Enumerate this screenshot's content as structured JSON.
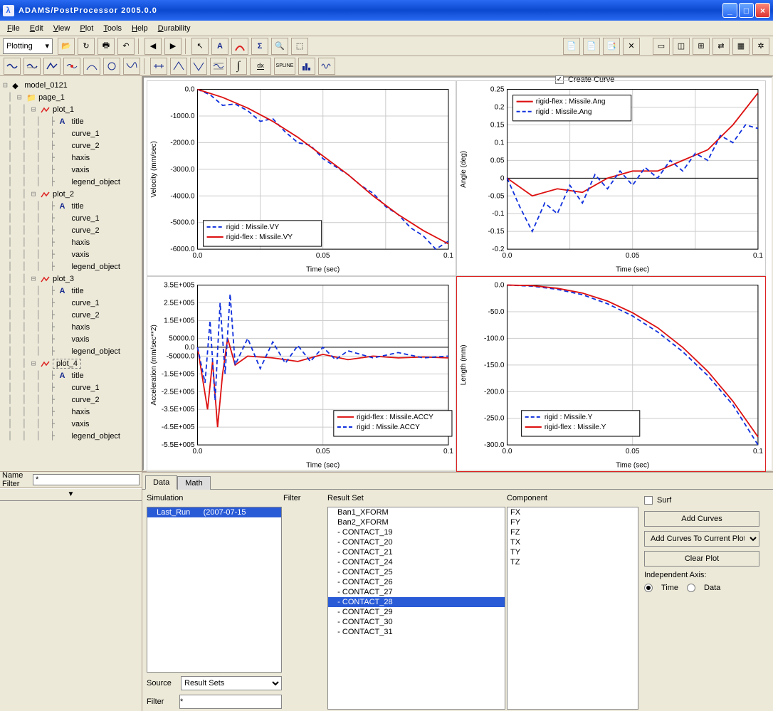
{
  "window": {
    "title": "ADAMS/PostProcessor 2005.0.0"
  },
  "menu": [
    "File",
    "Edit",
    "View",
    "Plot",
    "Tools",
    "Help",
    "Durability"
  ],
  "mode_select": "Plotting",
  "create_curve_label": "Create Curve",
  "create_curve_checked": true,
  "name_filter_label": "Name Filter",
  "name_filter_value": "*",
  "tree": [
    {
      "d": 0,
      "exp": "-",
      "icon": "model",
      "label": "model_0121"
    },
    {
      "d": 1,
      "exp": "-",
      "icon": "folder",
      "label": "page_1"
    },
    {
      "d": 2,
      "exp": "-",
      "icon": "plot",
      "label": "plot_1"
    },
    {
      "d": 3,
      "exp": "",
      "icon": "A",
      "label": "title"
    },
    {
      "d": 3,
      "exp": "",
      "icon": "blank",
      "label": "curve_1"
    },
    {
      "d": 3,
      "exp": "",
      "icon": "blank",
      "label": "curve_2"
    },
    {
      "d": 3,
      "exp": "",
      "icon": "blank",
      "label": "haxis"
    },
    {
      "d": 3,
      "exp": "",
      "icon": "blank",
      "label": "vaxis"
    },
    {
      "d": 3,
      "exp": "",
      "icon": "blank",
      "label": "legend_object"
    },
    {
      "d": 2,
      "exp": "-",
      "icon": "plot",
      "label": "plot_2"
    },
    {
      "d": 3,
      "exp": "",
      "icon": "A",
      "label": "title"
    },
    {
      "d": 3,
      "exp": "",
      "icon": "blank",
      "label": "curve_1"
    },
    {
      "d": 3,
      "exp": "",
      "icon": "blank",
      "label": "curve_2"
    },
    {
      "d": 3,
      "exp": "",
      "icon": "blank",
      "label": "haxis"
    },
    {
      "d": 3,
      "exp": "",
      "icon": "blank",
      "label": "vaxis"
    },
    {
      "d": 3,
      "exp": "",
      "icon": "blank",
      "label": "legend_object"
    },
    {
      "d": 2,
      "exp": "-",
      "icon": "plot",
      "label": "plot_3"
    },
    {
      "d": 3,
      "exp": "",
      "icon": "A",
      "label": "title"
    },
    {
      "d": 3,
      "exp": "",
      "icon": "blank",
      "label": "curve_1"
    },
    {
      "d": 3,
      "exp": "",
      "icon": "blank",
      "label": "curve_2"
    },
    {
      "d": 3,
      "exp": "",
      "icon": "blank",
      "label": "haxis"
    },
    {
      "d": 3,
      "exp": "",
      "icon": "blank",
      "label": "vaxis"
    },
    {
      "d": 3,
      "exp": "",
      "icon": "blank",
      "label": "legend_object"
    },
    {
      "d": 2,
      "exp": "-",
      "icon": "plot",
      "label": "plot_4",
      "sel": true
    },
    {
      "d": 3,
      "exp": "",
      "icon": "A",
      "label": "title"
    },
    {
      "d": 3,
      "exp": "",
      "icon": "blank",
      "label": "curve_1"
    },
    {
      "d": 3,
      "exp": "",
      "icon": "blank",
      "label": "curve_2"
    },
    {
      "d": 3,
      "exp": "",
      "icon": "blank",
      "label": "haxis"
    },
    {
      "d": 3,
      "exp": "",
      "icon": "blank",
      "label": "vaxis"
    },
    {
      "d": 3,
      "exp": "",
      "icon": "blank",
      "label": "legend_object"
    }
  ],
  "tabs": [
    "Data",
    "Math"
  ],
  "active_tab": "Data",
  "panel": {
    "simulation_label": "Simulation",
    "filter_label": "Filter",
    "resultset_label": "Result Set",
    "component_label": "Component",
    "surf_label": "Surf",
    "surf_checked": false,
    "add_curves": "Add Curves",
    "plot_target": "Add Curves To Current Plot",
    "clear_plot": "Clear Plot",
    "independent_axis": "Independent Axis:",
    "axis_time": "Time",
    "axis_data": "Data",
    "axis_selected": "Time",
    "source_label": "Source",
    "source_value": "Result Sets",
    "filter2_label": "Filter",
    "filter2_value": "*",
    "simulations": [
      {
        "name": "Last_Run",
        "date": "(2007-07-15",
        "sel": true
      }
    ],
    "result_sets": [
      "Ban1_XFORM",
      "Ban2_XFORM",
      "- CONTACT_19",
      "- CONTACT_20",
      "- CONTACT_21",
      "- CONTACT_24",
      "- CONTACT_25",
      "- CONTACT_26",
      "- CONTACT_27",
      "- CONTACT_28",
      "- CONTACT_29",
      "- CONTACT_30",
      "- CONTACT_31"
    ],
    "result_sel": "- CONTACT_28",
    "components": [
      "FX",
      "FY",
      "FZ",
      "TX",
      "TY",
      "TZ"
    ]
  },
  "chart_data": [
    {
      "type": "line",
      "title": "",
      "xlabel": "Time (sec)",
      "ylabel": "Velocity (mm/sec)",
      "xlim": [
        0.0,
        0.1
      ],
      "ylim": [
        -6000,
        0
      ],
      "xticks": [
        0.0,
        0.025,
        0.05,
        0.075,
        0.1
      ],
      "xtick_labels": [
        "0.0",
        "",
        "0.05",
        "",
        "0.1"
      ],
      "yticks": [
        0,
        -1000,
        -2000,
        -3000,
        -4000,
        -5000,
        -6000
      ],
      "ytick_labels": [
        "0.0",
        "-1000.0",
        "-2000.0",
        "-3000.0",
        "-4000.0",
        "-5000.0",
        "-6000.0"
      ],
      "series": [
        {
          "name": "rigid : Missile.VY",
          "color": "#1030dd",
          "dash": true,
          "x": [
            0.0,
            0.005,
            0.01,
            0.015,
            0.02,
            0.025,
            0.03,
            0.035,
            0.04,
            0.045,
            0.05,
            0.055,
            0.06,
            0.065,
            0.07,
            0.075,
            0.08,
            0.085,
            0.09,
            0.095,
            0.1
          ],
          "y": [
            0,
            -200,
            -600,
            -550,
            -800,
            -1200,
            -1100,
            -1600,
            -2000,
            -2100,
            -2600,
            -2900,
            -3200,
            -3600,
            -3900,
            -4400,
            -4700,
            -5200,
            -5500,
            -6000,
            -5700
          ]
        },
        {
          "name": "rigid-flex : Missile.VY",
          "color": "#dd1010",
          "dash": false,
          "x": [
            0.0,
            0.01,
            0.02,
            0.03,
            0.04,
            0.05,
            0.06,
            0.07,
            0.08,
            0.09,
            0.1
          ],
          "y": [
            0,
            -300,
            -700,
            -1200,
            -1800,
            -2500,
            -3200,
            -4000,
            -4700,
            -5300,
            -5800
          ]
        }
      ],
      "legend_pos": "bottom-left"
    },
    {
      "type": "line",
      "xlabel": "Time (sec)",
      "ylabel": "Angle (deg)",
      "xlim": [
        0.0,
        0.1
      ],
      "ylim": [
        -0.2,
        0.25
      ],
      "xticks": [
        0.0,
        0.025,
        0.05,
        0.075,
        0.1
      ],
      "xtick_labels": [
        "0.0",
        "",
        "0.05",
        "",
        "0.1"
      ],
      "yticks": [
        -0.2,
        -0.15,
        -0.1,
        -0.05,
        0.0,
        0.05,
        0.1,
        0.15,
        0.2,
        0.25
      ],
      "series": [
        {
          "name": "rigid-flex : Missile.Ang",
          "color": "#dd1010",
          "dash": false,
          "x": [
            0.0,
            0.01,
            0.02,
            0.03,
            0.04,
            0.05,
            0.06,
            0.07,
            0.08,
            0.09,
            0.1
          ],
          "y": [
            0,
            -0.05,
            -0.03,
            -0.04,
            0.0,
            0.02,
            0.02,
            0.05,
            0.08,
            0.15,
            0.24
          ]
        },
        {
          "name": "rigid : Missile.Ang",
          "color": "#1030dd",
          "dash": true,
          "x": [
            0.0,
            0.005,
            0.01,
            0.015,
            0.02,
            0.025,
            0.03,
            0.035,
            0.04,
            0.045,
            0.05,
            0.055,
            0.06,
            0.065,
            0.07,
            0.075,
            0.08,
            0.085,
            0.09,
            0.095,
            0.1
          ],
          "y": [
            0,
            -0.08,
            -0.15,
            -0.07,
            -0.1,
            -0.02,
            -0.07,
            0.01,
            -0.03,
            0.02,
            -0.02,
            0.03,
            0.0,
            0.05,
            0.02,
            0.07,
            0.05,
            0.12,
            0.1,
            0.15,
            0.14
          ]
        }
      ],
      "legend_pos": "top-left"
    },
    {
      "type": "line",
      "xlabel": "Time (sec)",
      "ylabel": "Acceleration (mm/sec**2)",
      "xlim": [
        0.0,
        0.1
      ],
      "ylim": [
        -550000,
        350000
      ],
      "xticks": [
        0.0,
        0.05,
        0.1
      ],
      "xtick_labels": [
        "0.0",
        "0.05",
        "0.1"
      ],
      "yticks": [
        -550000,
        -450000,
        -350000,
        -250000,
        -150000,
        -50000,
        0,
        50000,
        150000,
        250000,
        350000
      ],
      "ytick_labels": [
        "-5.5E+005",
        "-4.5E+005",
        "-3.5E+005",
        "-2.5E+005",
        "-1.5E+005",
        "-50000.0",
        "0.0",
        "50000.0",
        "1.5E+005",
        "2.5E+005",
        "3.5E+005"
      ],
      "series": [
        {
          "name": "rigid-flex : Missile.ACCY",
          "color": "#dd1010",
          "dash": false,
          "x": [
            0.0,
            0.004,
            0.006,
            0.008,
            0.01,
            0.012,
            0.015,
            0.02,
            0.03,
            0.04,
            0.05,
            0.06,
            0.07,
            0.08,
            0.09,
            0.1
          ],
          "y": [
            0,
            -350000,
            -80000,
            -450000,
            -150000,
            50000,
            -100000,
            -50000,
            -60000,
            -80000,
            -40000,
            -70000,
            -50000,
            -60000,
            -55000,
            -60000
          ]
        },
        {
          "name": "rigid : Missile.ACCY",
          "color": "#1030dd",
          "dash": true,
          "x": [
            0.0,
            0.003,
            0.005,
            0.007,
            0.009,
            0.011,
            0.013,
            0.015,
            0.02,
            0.025,
            0.03,
            0.035,
            0.04,
            0.045,
            0.05,
            0.055,
            0.06,
            0.07,
            0.08,
            0.09,
            0.1
          ],
          "y": [
            0,
            -200000,
            150000,
            -300000,
            250000,
            -150000,
            300000,
            -100000,
            50000,
            -120000,
            30000,
            -90000,
            10000,
            -80000,
            0,
            -70000,
            -20000,
            -60000,
            -30000,
            -60000,
            -50000
          ]
        }
      ],
      "legend_pos": "inner-right"
    },
    {
      "type": "line",
      "xlabel": "Time (sec)",
      "ylabel": "Length (mm)",
      "xlim": [
        0.0,
        0.1
      ],
      "ylim": [
        -300,
        0
      ],
      "xticks": [
        0.0,
        0.05,
        0.1
      ],
      "xtick_labels": [
        "0.0",
        "0.05",
        "0.1"
      ],
      "yticks": [
        0,
        -50,
        -100,
        -150,
        -200,
        -250,
        -300
      ],
      "ytick_labels": [
        "0.0",
        "-50.0",
        "-100.0",
        "-150.0",
        "-200.0",
        "-250.0",
        "-300.0"
      ],
      "series": [
        {
          "name": "rigid : Missile.Y",
          "color": "#1030dd",
          "dash": true,
          "x": [
            0.0,
            0.01,
            0.02,
            0.03,
            0.04,
            0.05,
            0.06,
            0.07,
            0.08,
            0.09,
            0.1
          ],
          "y": [
            0,
            -2,
            -8,
            -18,
            -35,
            -58,
            -88,
            -125,
            -170,
            -225,
            -300
          ]
        },
        {
          "name": "rigid-flex : Missile.Y",
          "color": "#dd1010",
          "dash": false,
          "x": [
            0.0,
            0.01,
            0.02,
            0.03,
            0.04,
            0.05,
            0.06,
            0.07,
            0.08,
            0.09,
            0.1
          ],
          "y": [
            0,
            -1,
            -6,
            -15,
            -30,
            -52,
            -80,
            -117,
            -162,
            -218,
            -285
          ]
        }
      ],
      "legend_pos": "inner-left",
      "active": true
    }
  ]
}
